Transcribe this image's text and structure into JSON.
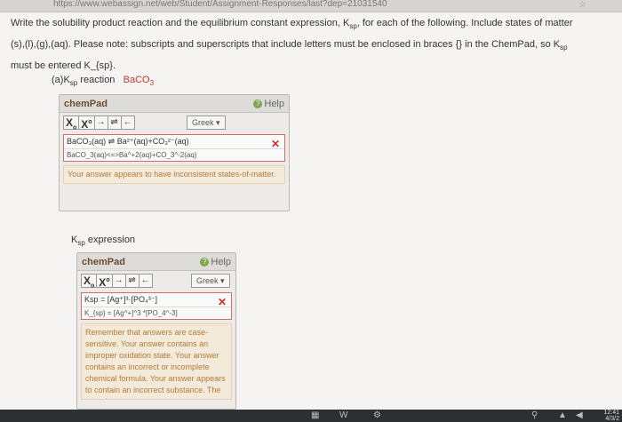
{
  "browser": {
    "url": "https://www.webassign.net/web/Student/Assignment-Responses/last?dep=21031540"
  },
  "instructions": {
    "line1": "Write the solubility product reaction and the equilibrium constant expression, K",
    "sub1": "sp",
    "line1b": ", for each of the following. Include states of matter",
    "line2": "(s),(l),(g),(aq). Please note: subscripts and superscripts that include letters must be enclosed in braces {} in the ChemPad, so K",
    "sub2": "sp",
    "line3": "must be entered K_{sp}."
  },
  "part_a": {
    "label_prefix": "(a)K",
    "label_sub": "sp",
    "label_suffix": " reaction",
    "formula": "BaCO",
    "formula_sub": "3"
  },
  "chempad1": {
    "title": "chemPad",
    "help": "Help",
    "greek": "Greek",
    "toolbar": [
      "X",
      "X",
      "→",
      "⇌",
      "←"
    ],
    "rendered_answer": "BaCO₃(aq) ⇌ Ba²⁺(aq)+CO₃²⁻(aq)",
    "raw_answer": "BaCO_3(aq)<=>Ba^+2(aq)+CO_3^-2(aq)",
    "feedback": "Your answer appears to have inconsistent states-of-matter."
  },
  "ksp_expression": {
    "label_prefix": "K",
    "label_sub": "sp",
    "label_suffix": " expression"
  },
  "chempad2": {
    "title": "chemPad",
    "help": "Help",
    "greek": "Greek",
    "toolbar": [
      "X",
      "X",
      "→",
      "⇌",
      "←"
    ],
    "rendered_answer": "Ksp = [Ag⁺]³·[PO₄³⁻]",
    "raw_answer": "K_{sp} = [Ag^+]^3 *[PO_4^-3]",
    "feedback": "Remember that answers are case-sensitive. Your answer contains an improper oxidation state. Your answer contains an incorrect or incomplete chemical formula. Your answer appears to contain an incorrect substance. The equation"
  },
  "taskbar": {
    "time": "12:41",
    "date": "4/3/2"
  },
  "colors": {
    "error": "#d12d2d",
    "feedback_bg": "#f3ead9",
    "feedback_text": "#b4793a",
    "chempad_title": "#6d4b2e"
  }
}
